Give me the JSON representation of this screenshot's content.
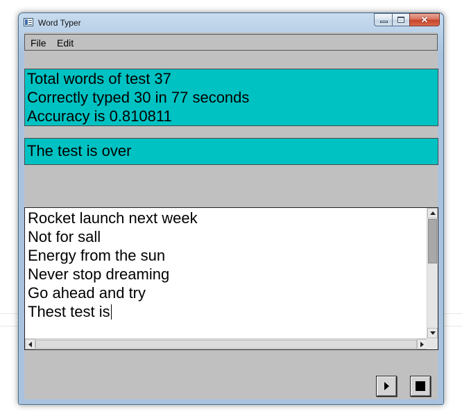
{
  "window": {
    "title": "Word Typer",
    "close_glyph": "✕"
  },
  "icons": [
    "app-icon",
    "minimize-icon",
    "maximize-icon",
    "close-icon",
    "play-icon",
    "stop-icon",
    "scroll-arrow-icons"
  ],
  "colors": {
    "panel_accent": "#00c2c2",
    "client_background": "#c0c0c0",
    "editor_background": "#ffffff"
  },
  "menu": {
    "file": "File",
    "edit": "Edit"
  },
  "stats": {
    "line1": "Total words of test 37",
    "line2": "Correctly typed 30 in 77 seconds",
    "line3": "Accuracy is 0.810811"
  },
  "status": {
    "message": "The test is over"
  },
  "editor": {
    "lines": [
      "Rocket launch next week",
      "Not for sall",
      "Energy from the sun",
      "Never stop dreaming",
      "Go ahead and try",
      "Thest test is"
    ]
  }
}
